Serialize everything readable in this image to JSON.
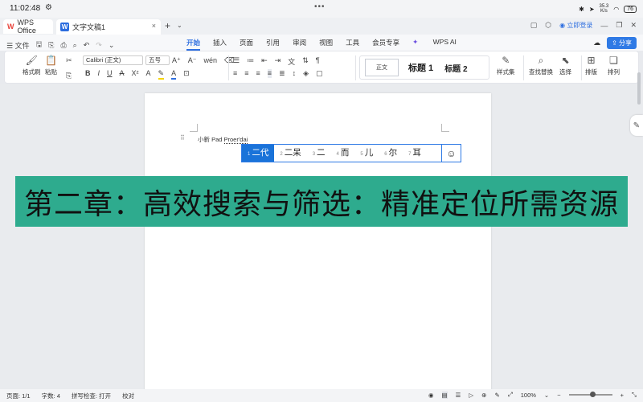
{
  "status": {
    "time": "11:02:48",
    "net_speed_top": "35.3",
    "net_speed_bottom": "K/s",
    "battery": "76"
  },
  "tabs": {
    "app": "WPS Office",
    "doc": "文字文稿1"
  },
  "header": {
    "login": "立即登录"
  },
  "menu": {
    "file": "文件",
    "tabs": [
      "开始",
      "插入",
      "页面",
      "引用",
      "审阅",
      "视图",
      "工具",
      "会员专享",
      "WPS AI"
    ],
    "active_tab": "开始",
    "share": "分享"
  },
  "ribbon": {
    "format_painter": "格式刷",
    "paste": "粘贴",
    "font_name": "Calibri (正文)",
    "font_size": "五号",
    "style_normal": "正文",
    "style_h1": "标题 1",
    "style_h2": "标题 2",
    "style_set": "样式集",
    "find_replace": "查找替换",
    "select": "选择",
    "arrange": "排版",
    "sort": "排列"
  },
  "document": {
    "line_prefix": "小新 Pad ",
    "line_pinyin": "Proer'dai"
  },
  "ime": {
    "candidates": [
      {
        "num": "1",
        "text": "二代"
      },
      {
        "num": "2",
        "text": "二呆"
      },
      {
        "num": "3",
        "text": "二"
      },
      {
        "num": "4",
        "text": "而"
      },
      {
        "num": "5",
        "text": "儿"
      },
      {
        "num": "6",
        "text": "尔"
      },
      {
        "num": "7",
        "text": "耳"
      }
    ],
    "selected_index": 0
  },
  "banner": {
    "text": "第二章：高效搜索与筛选：精准定位所需资源"
  },
  "bottom": {
    "page": "页面: 1/1",
    "words": "字数: 4",
    "spell": "拼写检查: 打开",
    "proof": "校对",
    "zoom": "100%"
  },
  "colors": {
    "accent": "#2f6fe0",
    "banner_bg": "#2eab8e",
    "ime_selected": "#1a73d9"
  }
}
